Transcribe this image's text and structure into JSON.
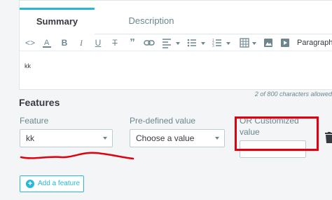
{
  "tabs": [
    {
      "label": "Summary",
      "active": true
    },
    {
      "label": "Description",
      "active": false
    }
  ],
  "toolbar": {
    "code": "<>",
    "paragraph_label": "Paragraph"
  },
  "editor": {
    "content": "kk",
    "char_count": "2 of 800 characters allowed"
  },
  "features": {
    "title": "Features",
    "feature_label": "Feature",
    "feature_value": "kk",
    "predefined_label": "Pre-defined value",
    "predefined_value": "Choose a value",
    "customized_label_1": "OR Customized",
    "customized_label_2": "value",
    "customized_value": "",
    "add_button": "Add a feature"
  },
  "colors": {
    "accent": "#25b9d7",
    "annotation_red": "#e2000f"
  }
}
